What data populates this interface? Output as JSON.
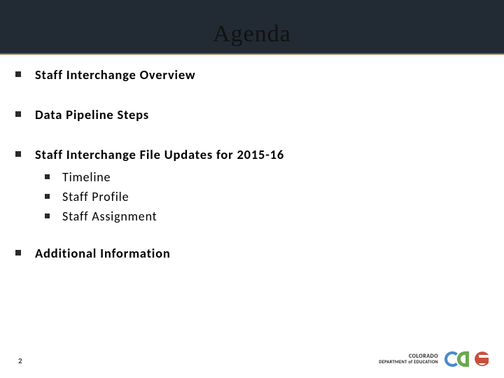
{
  "title": "Agenda",
  "bullets": {
    "b0": "Staff Interchange Overview",
    "b1": "Data Pipeline Steps",
    "b2": "Staff Interchange File Updates for 2015-16",
    "sub": {
      "s0": "Timeline",
      "s1": "Staff Profile",
      "s2": "Staff Assignment"
    },
    "b3": "Additional Information"
  },
  "page_number": "2",
  "logo": {
    "line1": "COLORADO",
    "line2": "DEPARTMENT of EDUCATION",
    "mark_alt": "cde"
  }
}
